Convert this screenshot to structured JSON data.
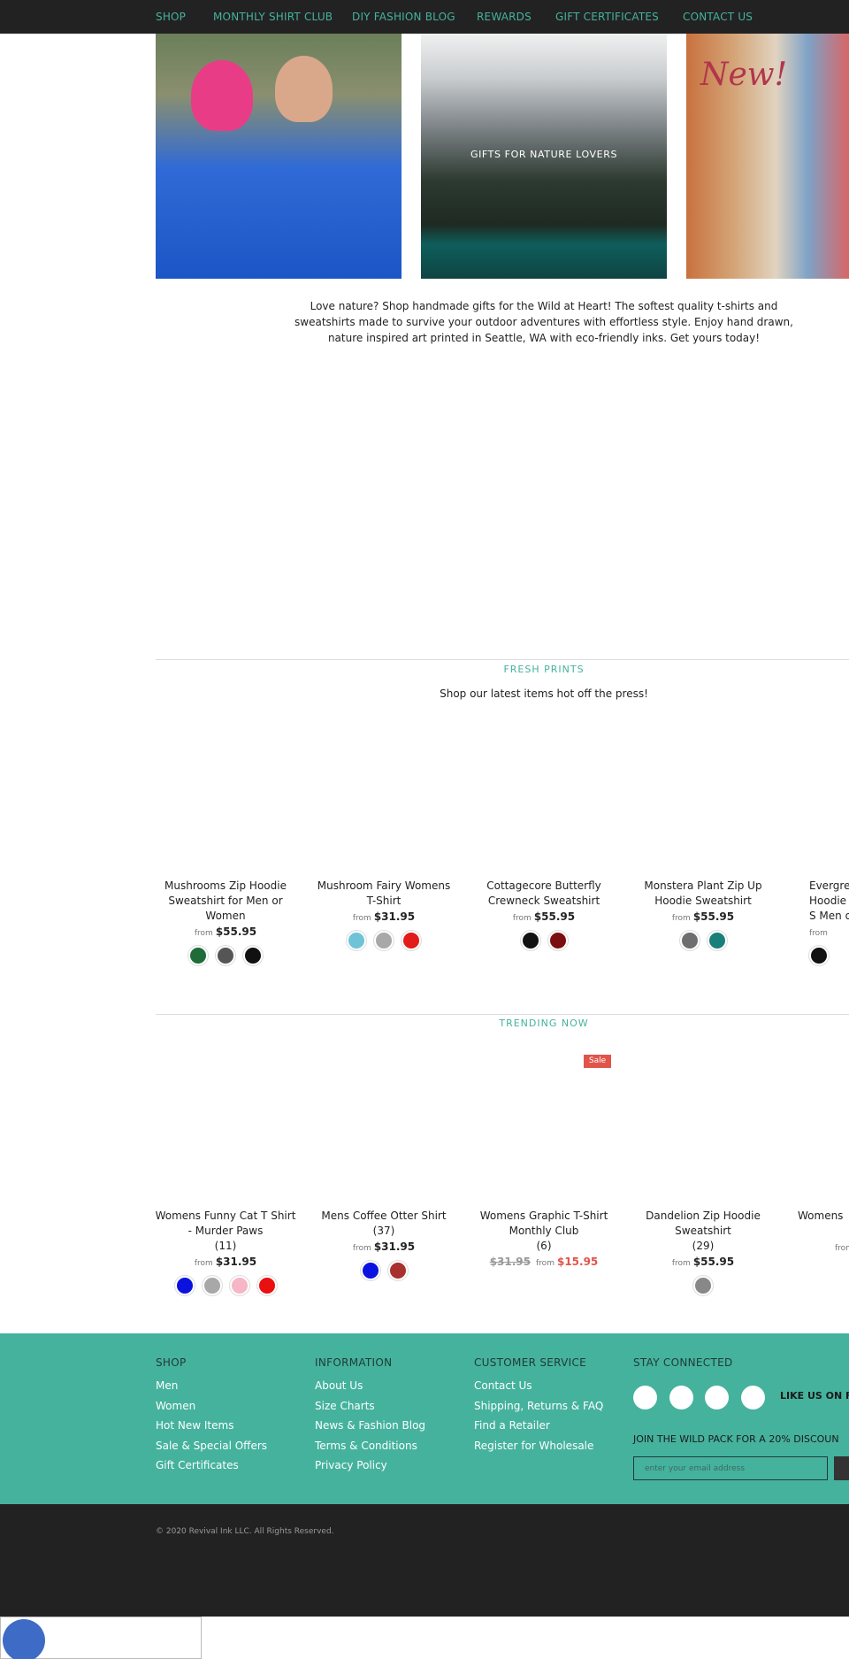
{
  "nav": {
    "items": [
      "SHOP",
      "MONTHLY SHIRT CLUB",
      "DIY FASHION BLOG",
      "REWARDS",
      "GIFT CERTIFICATES",
      "CONTACT US"
    ]
  },
  "hero": {
    "caption": "GIFTS FOR NATURE LOVERS",
    "new_label": "New!"
  },
  "intro": "Love nature? Shop handmade gifts for the Wild at Heart! The softest quality t-shirts and sweatshirts made to survive your outdoor adventures with effortless style. Enjoy hand drawn, nature inspired art printed in Seattle, WA with eco-friendly inks. Get yours today!",
  "fresh": {
    "heading": "FRESH PRINTS",
    "subheading": "Shop our latest items hot off the press!",
    "products": [
      {
        "title": "Mushrooms Zip Hoodie Sweatshirt for Men or Women",
        "from": "from",
        "price": "$55.95",
        "swatches": [
          "#1f6b3a",
          "#555555",
          "#111111"
        ]
      },
      {
        "title": "Mushroom Fairy Womens T-Shirt",
        "from": "from",
        "price": "$31.95",
        "swatches": [
          "#6ec3d6",
          "#a8a8a8",
          "#e21b1b"
        ]
      },
      {
        "title": "Cottagecore Butterfly Crewneck Sweatshirt",
        "from": "from",
        "price": "$55.95",
        "swatches": [
          "#111111",
          "#7a0f12"
        ]
      },
      {
        "title": "Monstera Plant Zip Up Hoodie Sweatshirt",
        "from": "from",
        "price": "$55.95",
        "swatches": [
          "#6e6e70",
          "#1a7f7a"
        ]
      },
      {
        "title": "Evergre Hoodie S Men o",
        "from": "from",
        "price": "",
        "swatches": [
          "#111111"
        ]
      }
    ]
  },
  "trending": {
    "heading": "TRENDING NOW",
    "sale_badge": "Sale",
    "products": [
      {
        "title": "Womens Funny Cat T Shirt - Murder Paws",
        "count": "(11)",
        "from": "from",
        "price": "$31.95",
        "swatches": [
          "#0b12e0",
          "#a8a8a8",
          "#f6b6c6",
          "#e81010"
        ]
      },
      {
        "title": "Mens Coffee Otter Shirt",
        "count": "(37)",
        "from": "from",
        "price": "$31.95",
        "swatches": [
          "#0b12e0",
          "#a8302e"
        ]
      },
      {
        "title": "Womens Graphic T-Shirt Monthly Club",
        "count": "(6)",
        "old_price": "$31.95",
        "from": "from",
        "price": "$15.95",
        "swatches": []
      },
      {
        "title": "Dandelion Zip Hoodie Sweatshirt",
        "count": "(29)",
        "from": "from",
        "price": "$55.95",
        "swatches": [
          "#888888"
        ]
      },
      {
        "title": "Womens",
        "count": "",
        "from": "from",
        "price": "",
        "swatches": []
      }
    ]
  },
  "footer": {
    "shop": {
      "heading": "SHOP",
      "links": [
        "Men",
        "Women",
        "Hot New Items",
        "Sale & Special Offers",
        "Gift Certificates"
      ]
    },
    "information": {
      "heading": "INFORMATION",
      "links": [
        "About Us",
        "Size Charts",
        "News & Fashion Blog",
        "Terms & Conditions",
        "Privacy Policy"
      ]
    },
    "customer_service": {
      "heading": "CUSTOMER SERVICE",
      "links": [
        "Contact Us",
        "Shipping, Returns & FAQ",
        "Find a Retailer",
        "Register for Wholesale"
      ]
    },
    "stay_connected": {
      "heading": "STAY CONNECTED",
      "like_text": "LIKE US ON FA",
      "join_text": "JOIN THE WILD PACK FOR A 20% DISCOUN",
      "email_placeholder": "enter your email address"
    },
    "copyright": "© 2020 Revival Ink LLC. All Rights Reserved."
  },
  "colors": {
    "accent": "#45b29d",
    "nav_bg": "#222222",
    "sale": "#e0544a",
    "chat": "#3d6bc6"
  }
}
